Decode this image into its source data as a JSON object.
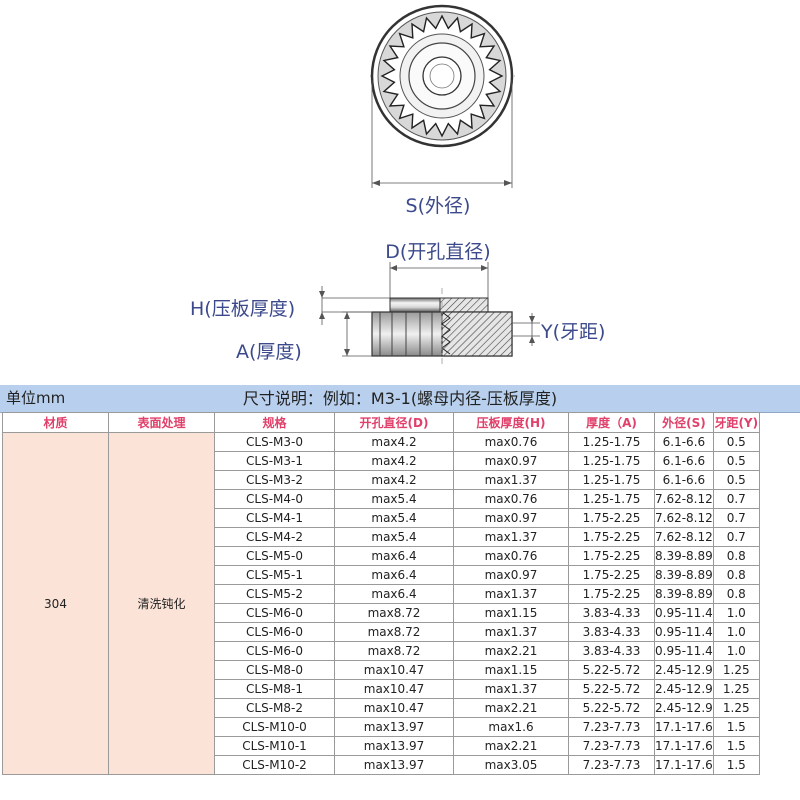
{
  "diagram": {
    "label_s": "S(外径)",
    "label_d": "D(开孔直径)",
    "label_h": "H(压板厚度)",
    "label_a": "A(厚度)",
    "label_y": "Y(牙距)"
  },
  "banner": {
    "unit": "单位mm",
    "example": "尺寸说明：例如：M3-1(螺母内径-压板厚度)"
  },
  "table": {
    "headers": [
      "材质",
      "表面处理",
      "规格",
      "开孔直径(D)",
      "压板厚度(H)",
      "厚度（A)",
      "外径(S)",
      "牙距(Y)"
    ],
    "material": "304",
    "surface": "清洗钝化",
    "rows": [
      [
        "CLS-M3-0",
        "max4.2",
        "max0.76",
        "1.25-1.75",
        "6.1-6.6",
        "0.5"
      ],
      [
        "CLS-M3-1",
        "max4.2",
        "max0.97",
        "1.25-1.75",
        "6.1-6.6",
        "0.5"
      ],
      [
        "CLS-M3-2",
        "max4.2",
        "max1.37",
        "1.25-1.75",
        "6.1-6.6",
        "0.5"
      ],
      [
        "CLS-M4-0",
        "max5.4",
        "max0.76",
        "1.25-1.75",
        "7.62-8.12",
        "0.7"
      ],
      [
        "CLS-M4-1",
        "max5.4",
        "max0.97",
        "1.75-2.25",
        "7.62-8.12",
        "0.7"
      ],
      [
        "CLS-M4-2",
        "max5.4",
        "max1.37",
        "1.75-2.25",
        "7.62-8.12",
        "0.7"
      ],
      [
        "CLS-M5-0",
        "max6.4",
        "max0.76",
        "1.75-2.25",
        "8.39-8.89",
        "0.8"
      ],
      [
        "CLS-M5-1",
        "max6.4",
        "max0.97",
        "1.75-2.25",
        "8.39-8.89",
        "0.8"
      ],
      [
        "CLS-M5-2",
        "max6.4",
        "max1.37",
        "1.75-2.25",
        "8.39-8.89",
        "0.8"
      ],
      [
        "CLS-M6-0",
        "max8.72",
        "max1.15",
        "3.83-4.33",
        "0.95-11.4",
        "1.0"
      ],
      [
        "CLS-M6-0",
        "max8.72",
        "max1.37",
        "3.83-4.33",
        "0.95-11.4",
        "1.0"
      ],
      [
        "CLS-M6-0",
        "max8.72",
        "max2.21",
        "3.83-4.33",
        "0.95-11.4",
        "1.0"
      ],
      [
        "CLS-M8-0",
        "max10.47",
        "max1.15",
        "5.22-5.72",
        "2.45-12.9",
        "1.25"
      ],
      [
        "CLS-M8-1",
        "max10.47",
        "max1.37",
        "5.22-5.72",
        "2.45-12.9",
        "1.25"
      ],
      [
        "CLS-M8-2",
        "max10.47",
        "max2.21",
        "5.22-5.72",
        "2.45-12.9",
        "1.25"
      ],
      [
        "CLS-M10-0",
        "max13.97",
        "max1.6",
        "7.23-7.73",
        "17.1-17.6",
        "1.5"
      ],
      [
        "CLS-M10-1",
        "max13.97",
        "max2.21",
        "7.23-7.73",
        "17.1-17.6",
        "1.5"
      ],
      [
        "CLS-M10-2",
        "max13.97",
        "max3.05",
        "7.23-7.73",
        "17.1-17.6",
        "1.5"
      ]
    ]
  }
}
